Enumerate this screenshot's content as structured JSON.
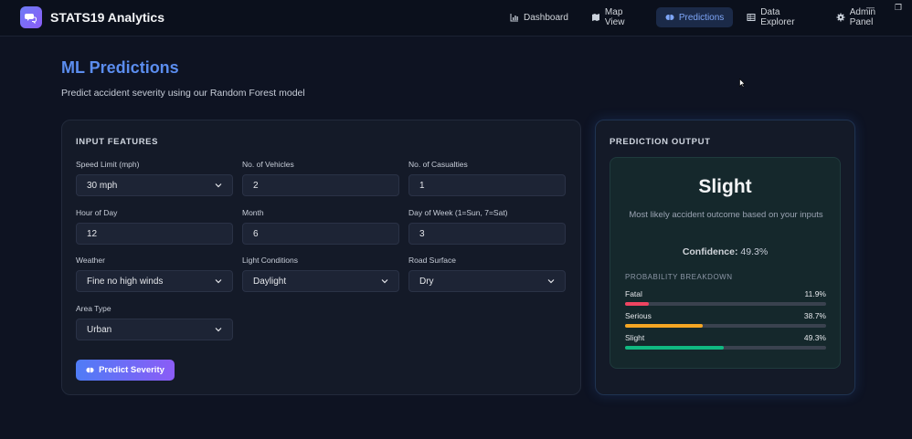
{
  "app": {
    "title": "STATS19 Analytics"
  },
  "nav": [
    {
      "label": "Dashboard",
      "icon": "chart-icon"
    },
    {
      "label": "Map View",
      "icon": "map-icon"
    },
    {
      "label": "Predictions",
      "icon": "brain-icon",
      "active": true
    },
    {
      "label": "Data Explorer",
      "icon": "table-icon"
    },
    {
      "label": "Admin Panel",
      "icon": "gear-icon"
    }
  ],
  "page": {
    "title": "ML Predictions",
    "subtitle": "Predict accident severity using our Random Forest model"
  },
  "inputs": {
    "section_title": "INPUT FEATURES",
    "speed_limit": {
      "label": "Speed Limit (mph)",
      "value": "30 mph"
    },
    "vehicles": {
      "label": "No. of Vehicles",
      "value": "2"
    },
    "casualties": {
      "label": "No. of Casualties",
      "value": "1"
    },
    "hour": {
      "label": "Hour of Day",
      "value": "12"
    },
    "month": {
      "label": "Month",
      "value": "6"
    },
    "day_of_week": {
      "label": "Day of Week (1=Sun, 7=Sat)",
      "value": "3"
    },
    "weather": {
      "label": "Weather",
      "value": "Fine no high winds"
    },
    "light": {
      "label": "Light Conditions",
      "value": "Daylight"
    },
    "road_surface": {
      "label": "Road Surface",
      "value": "Dry"
    },
    "area_type": {
      "label": "Area Type",
      "value": "Urban"
    },
    "predict_label": "Predict Severity"
  },
  "output": {
    "section_title": "PREDICTION OUTPUT",
    "result": "Slight",
    "description": "Most likely accident outcome based on your inputs",
    "confidence_label": "Confidence:",
    "confidence_value": "49.3%",
    "breakdown_title": "PROBABILITY BREAKDOWN",
    "probabilities": [
      {
        "label": "Fatal",
        "value_text": "11.9%",
        "value": 11.9,
        "color": "#ef4461"
      },
      {
        "label": "Serious",
        "value_text": "38.7%",
        "value": 38.7,
        "color": "#f5a623"
      },
      {
        "label": "Slight",
        "value_text": "49.3%",
        "value": 49.3,
        "color": "#10b981"
      }
    ]
  },
  "colors": {
    "accent": "#5b8def",
    "background": "#0e1322"
  }
}
